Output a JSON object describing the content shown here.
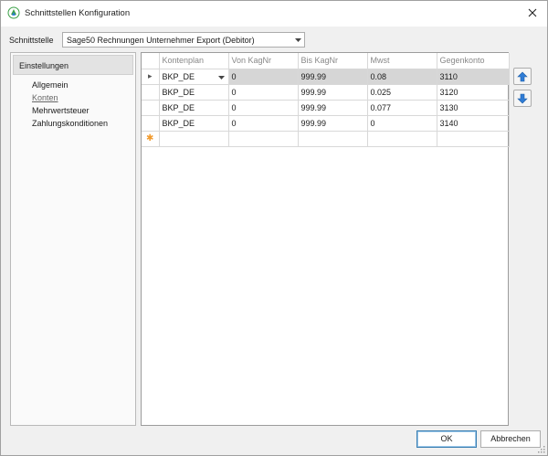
{
  "window": {
    "title": "Schnittstellen Konfiguration"
  },
  "schnittstelle": {
    "label": "Schnittstelle",
    "value": "Sage50 Rechnungen Unternehmer Export (Debitor)"
  },
  "sidebar": {
    "header": "Einstellungen",
    "items": [
      {
        "label": "Allgemein"
      },
      {
        "label": "Konten",
        "active": true
      },
      {
        "label": "Mehrwertsteuer"
      },
      {
        "label": "Zahlungskonditionen"
      }
    ]
  },
  "grid": {
    "columns": [
      "Kontenplan",
      "Von KagNr",
      "Bis KagNr",
      "Mwst",
      "Gegenkonto"
    ],
    "rows": [
      {
        "kontenplan": "BKP_DE",
        "von": "0",
        "bis": "999.99",
        "mwst": "0.08",
        "gegenkonto": "3110"
      },
      {
        "kontenplan": "BKP_DE",
        "von": "0",
        "bis": "999.99",
        "mwst": "0.025",
        "gegenkonto": "3120"
      },
      {
        "kontenplan": "BKP_DE",
        "von": "0",
        "bis": "999.99",
        "mwst": "0.077",
        "gegenkonto": "3130"
      },
      {
        "kontenplan": "BKP_DE",
        "von": "0",
        "bis": "999.99",
        "mwst": "0",
        "gegenkonto": "3140"
      }
    ],
    "current_row_marker": "▸",
    "new_row_marker": "✱"
  },
  "buttons": {
    "ok": "OK",
    "cancel": "Abbrechen"
  },
  "icons": {
    "app": "app-logo-icon",
    "close": "close-icon",
    "move_up": "arrow-up-icon",
    "move_down": "arrow-down-icon"
  },
  "colors": {
    "accent_blue": "#2f7cd6",
    "selected_row": "#d6d6d6",
    "new_row_marker": "#f29b2e"
  }
}
